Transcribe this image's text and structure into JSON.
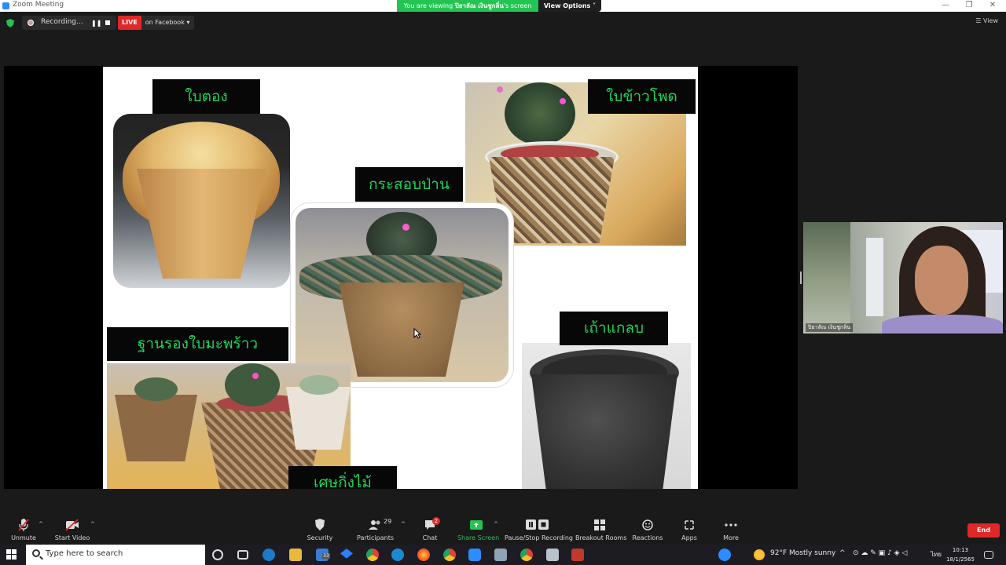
{
  "window": {
    "title": "Zoom Meeting",
    "controls": [
      "—",
      "❐",
      "✕"
    ]
  },
  "banner": {
    "prefix": "You are viewing ",
    "presenter": "ปิยาลัณ เงินชูกลิ่น",
    "suffix": "'s screen",
    "view_options": "View Options ˅"
  },
  "toolbar": {
    "recording_label": "Recording...",
    "pause_symbol": "❚❚",
    "live_badge": "LIVE",
    "live_target": "on Facebook ▾",
    "view_label": "☰ View"
  },
  "slide": {
    "labels": [
      "ใบตอง",
      "ใบข้าวโพด",
      "กระสอบป่าน",
      "ฐานรองใบมะพร้าว",
      "เถ้าแกลบ",
      "เศษกิ่งไม้"
    ]
  },
  "participant": {
    "name": "ปิยาลัณ เงินชูกลิ่น"
  },
  "controls": {
    "unmute": "Unmute",
    "start_video": "Start Video",
    "security": "Security",
    "participants": "Participants",
    "participants_count": "29",
    "chat": "Chat",
    "chat_badge": "2",
    "share_screen": "Share Screen",
    "pause_stop_recording": "Pause/Stop Recording",
    "breakout_rooms": "Breakout Rooms",
    "reactions": "Reactions",
    "apps": "Apps",
    "more": "More",
    "end": "End"
  },
  "taskbar": {
    "search_placeholder": "Type here to search",
    "mail_badge": "33",
    "weather": "92°F  Mostly sunny",
    "lang": "ไทย",
    "time": "10:13",
    "date": "18/1/2565"
  },
  "colors": {
    "accent_green": "#23c552",
    "live_red": "#e02828",
    "zoom_blue": "#2d8cff",
    "label_green": "#1fd35a"
  }
}
